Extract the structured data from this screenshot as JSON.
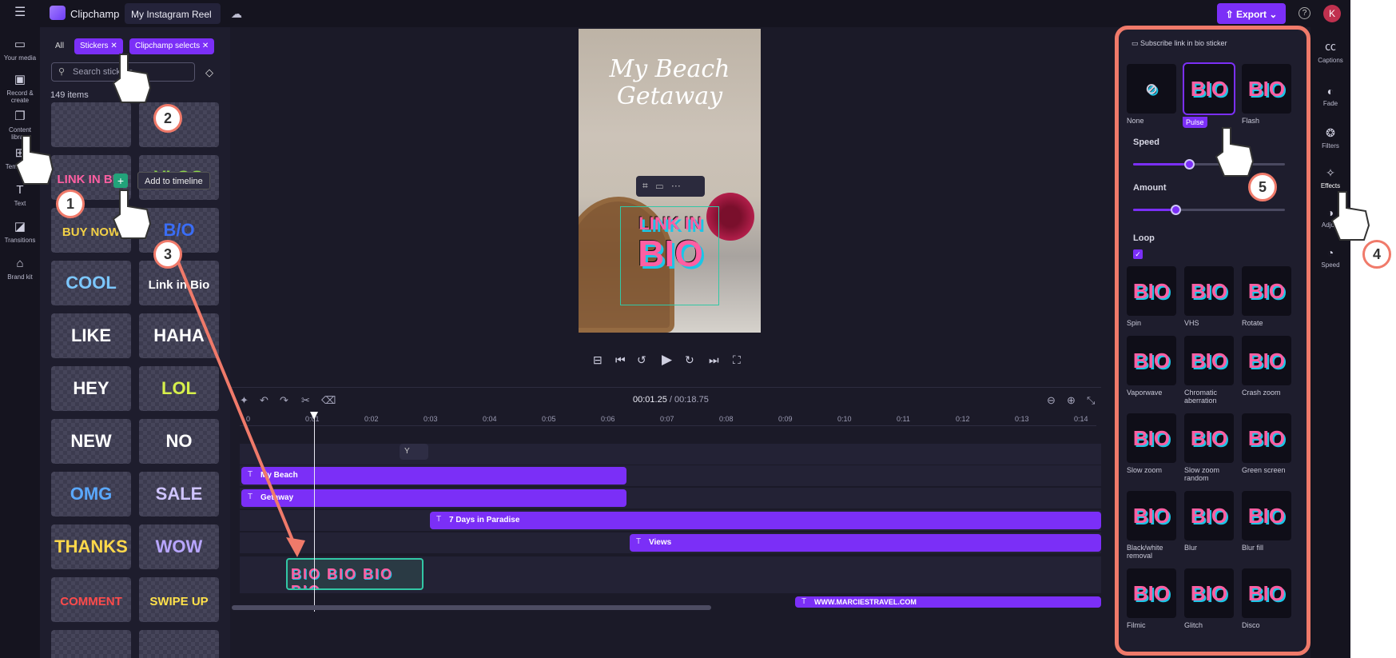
{
  "topbar": {
    "app_name": "Clipchamp",
    "project_name": "My Instagram Reel",
    "export_label": "Export",
    "avatar_initial": "K"
  },
  "leftnav": [
    {
      "label": "Your media",
      "icon": "folder-icon"
    },
    {
      "label": "Record & create",
      "icon": "camera-icon"
    },
    {
      "label": "Content library",
      "icon": "library-icon"
    },
    {
      "label": "Templates",
      "icon": "grid-icon"
    },
    {
      "label": "Text",
      "icon": "text-icon"
    },
    {
      "label": "Transitions",
      "icon": "transitions-icon"
    },
    {
      "label": "Brand kit",
      "icon": "brand-icon"
    }
  ],
  "library": {
    "filter_all": "All",
    "filter_chips": [
      "Stickers",
      "Clipchamp selects"
    ],
    "search_placeholder": "Search stickers",
    "count": "149 items",
    "tooltip": "Add to timeline",
    "stickers": [
      {
        "text": "",
        "color": "#e45ea8"
      },
      {
        "text": "",
        "color": "#e45ea8"
      },
      {
        "text": "LINK IN BIO",
        "color": "#ff5fa2"
      },
      {
        "text": "VLOG",
        "color": "#8ad34a"
      },
      {
        "text": "BUY NOW",
        "color": "#f2d046"
      },
      {
        "text": "B/O",
        "color": "#3a6df5"
      },
      {
        "text": "COOL",
        "color": "#7cc7ff"
      },
      {
        "text": "Link in Bio",
        "color": "#ffffff"
      },
      {
        "text": "LIKE",
        "color": "#ffffff"
      },
      {
        "text": "HAHA",
        "color": "#ffffff"
      },
      {
        "text": "HEY",
        "color": "#ffffff"
      },
      {
        "text": "LOL",
        "color": "#d7f04b"
      },
      {
        "text": "NEW",
        "color": "#ffffff"
      },
      {
        "text": "NO",
        "color": "#ffffff"
      },
      {
        "text": "OMG",
        "color": "#5aa8ff"
      },
      {
        "text": "SALE",
        "color": "#cfc4ff"
      },
      {
        "text": "THANKS",
        "color": "#ffd84a"
      },
      {
        "text": "WOW",
        "color": "#b8a6ff"
      },
      {
        "text": "COMMENT",
        "color": "#ff4b4b"
      },
      {
        "text": "SWIPE UP",
        "color": "#ffe14a"
      },
      {
        "text": "",
        "color": "#ff6b6b"
      },
      {
        "text": "",
        "color": "#ff3d6e"
      }
    ]
  },
  "preview": {
    "title_line1": "My Beach",
    "title_line2": "Getaway",
    "sticker_small": "LINK IN",
    "sticker_big": "BIO"
  },
  "timeline": {
    "current_time": "00:01.25",
    "total_time": "/ 00:18.75",
    "ruler": [
      "0",
      "0:01",
      "0:02",
      "0:03",
      "0:04",
      "0:05",
      "0:06",
      "0:07",
      "0:08",
      "0:09",
      "0:10",
      "0:11",
      "0:12",
      "0:13",
      "0:14"
    ],
    "mini_clip": "Y",
    "clips": [
      {
        "label": "My Beach"
      },
      {
        "label": "Getaway"
      },
      {
        "label": "7 Days in Paradise"
      },
      {
        "label": "Views"
      },
      {
        "label": "WWW.MARCIESTRAVEL.COM"
      }
    ],
    "sticker_clip": "BIO BIO BIO BIO"
  },
  "effects_panel": {
    "title": "Subscribe link in bio sticker",
    "speed_label": "Speed",
    "amount_label": "Amount",
    "loop_label": "Loop",
    "speed_value": 0.37,
    "amount_value": 0.28,
    "top_effects": [
      {
        "label": "None"
      },
      {
        "label": "Pulse",
        "selected": true
      },
      {
        "label": "Flash"
      }
    ],
    "effects": [
      {
        "label": "Spin"
      },
      {
        "label": "VHS"
      },
      {
        "label": "Rotate"
      },
      {
        "label": "Vaporwave"
      },
      {
        "label": "Chromatic aberration"
      },
      {
        "label": "Crash zoom"
      },
      {
        "label": "Slow zoom"
      },
      {
        "label": "Slow zoom random"
      },
      {
        "label": "Green screen"
      },
      {
        "label": "Black/white removal"
      },
      {
        "label": "Blur"
      },
      {
        "label": "Blur fill"
      },
      {
        "label": "Filmic"
      },
      {
        "label": "Glitch"
      },
      {
        "label": "Disco"
      }
    ]
  },
  "rightnav": [
    {
      "label": "Captions",
      "icon": "captions-icon"
    },
    {
      "label": "Fade",
      "icon": "fade-icon"
    },
    {
      "label": "Filters",
      "icon": "filters-icon"
    },
    {
      "label": "Effects",
      "icon": "effects-icon"
    },
    {
      "label": "Adjust",
      "icon": "adjust-icon"
    },
    {
      "label": "Speed",
      "icon": "speed-icon"
    }
  ],
  "annotations": [
    "1",
    "2",
    "3",
    "4",
    "5"
  ]
}
